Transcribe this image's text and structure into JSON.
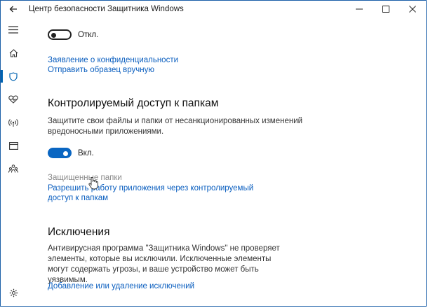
{
  "window": {
    "title": "Центр безопасности Защитника Windows"
  },
  "nav": {
    "items": [
      {
        "name": "menu-icon"
      },
      {
        "name": "home-icon"
      },
      {
        "name": "shield-icon",
        "active": true
      },
      {
        "name": "heart-icon"
      },
      {
        "name": "wireless-icon"
      },
      {
        "name": "browser-window-icon"
      },
      {
        "name": "family-icon"
      }
    ],
    "settings": "gear-icon"
  },
  "top_toggle": {
    "state": "off",
    "label": "Откл."
  },
  "links_top": {
    "privacy": "Заявление о конфиденциальности",
    "send_sample": "Отправить образец вручную"
  },
  "cfa": {
    "heading": "Контролируемый доступ к папкам",
    "description": "Защитите свои файлы и папки от несанкционированных изменений вредоносными приложениями.",
    "toggle_state": "on",
    "toggle_label": "Вкл.",
    "protected_folders": "Защищенные папки",
    "allow_app_line1": "Разрешить работу приложения через контролируемый",
    "allow_app_line2": "доступ к папкам"
  },
  "exclusions": {
    "heading": "Исключения",
    "description": "Антивирусная программа \"Защитника Windows\" не проверяет элементы, которые вы исключили. Исключенные элементы могут содержать угрозы, и ваше устройство может быть уязвимым.",
    "link": "Добавление или удаление исключений"
  },
  "colors": {
    "accent": "#0a66c2",
    "link": "#0a5ebf",
    "window_border": "#1b5fa8"
  }
}
